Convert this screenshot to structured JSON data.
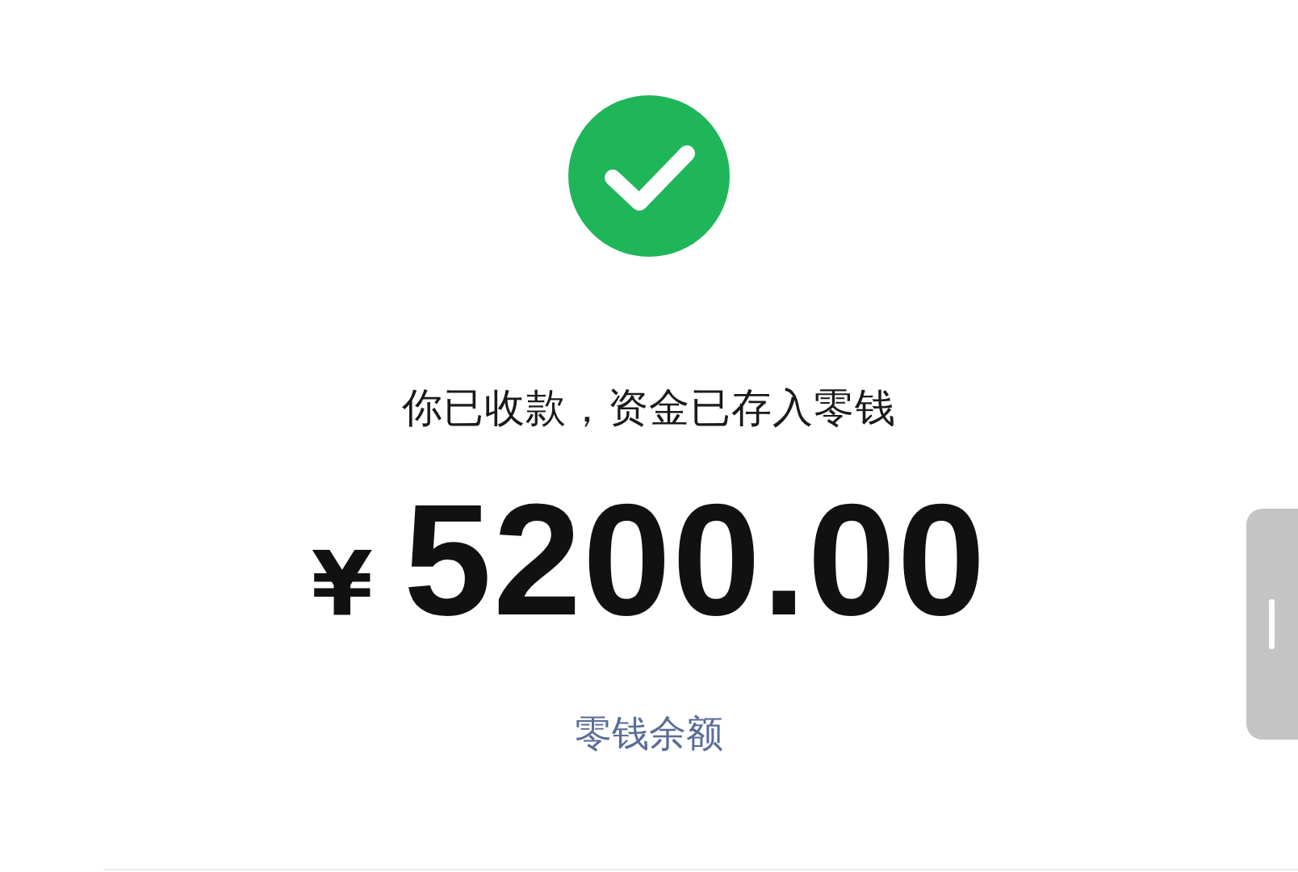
{
  "message": "你已收款，资金已存入零钱",
  "amount": {
    "currency": "¥",
    "value": "5200.00"
  },
  "link": "零钱余额"
}
